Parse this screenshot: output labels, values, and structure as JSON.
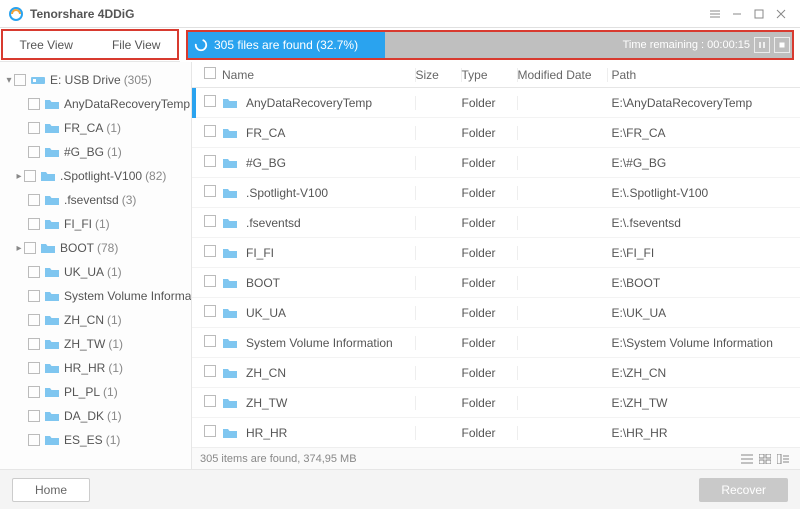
{
  "title": "Tenorshare 4DDiG",
  "view_tabs": {
    "tree": "Tree View",
    "file": "File View"
  },
  "progress": {
    "text": "305 files are found (32.7%)",
    "percent": 32.7,
    "time_remaining": "Time remaining : 00:00:15"
  },
  "sidebar": {
    "root": {
      "label": "E: USB Drive",
      "count": "(305)"
    },
    "items": [
      {
        "label": "AnyDataRecoveryTemp",
        "count": ""
      },
      {
        "label": "FR_CA",
        "count": "(1)"
      },
      {
        "label": "#G_BG",
        "count": "(1)"
      },
      {
        "label": ".Spotlight-V100",
        "count": "(82)",
        "expandable": true
      },
      {
        "label": ".fseventsd",
        "count": "(3)"
      },
      {
        "label": "FI_FI",
        "count": "(1)"
      },
      {
        "label": "BOOT",
        "count": "(78)",
        "expandable": true
      },
      {
        "label": "UK_UA",
        "count": "(1)"
      },
      {
        "label": "System Volume Information",
        "count": ""
      },
      {
        "label": "ZH_CN",
        "count": "(1)"
      },
      {
        "label": "ZH_TW",
        "count": "(1)"
      },
      {
        "label": "HR_HR",
        "count": "(1)"
      },
      {
        "label": "PL_PL",
        "count": "(1)"
      },
      {
        "label": "DA_DK",
        "count": "(1)"
      },
      {
        "label": "ES_ES",
        "count": "(1)"
      }
    ]
  },
  "table": {
    "headers": {
      "name": "Name",
      "size": "Size",
      "type": "Type",
      "date": "Modified Date",
      "path": "Path"
    },
    "rows": [
      {
        "name": "AnyDataRecoveryTemp",
        "type": "Folder",
        "path": "E:\\AnyDataRecoveryTemp",
        "selected": true
      },
      {
        "name": "FR_CA",
        "type": "Folder",
        "path": "E:\\FR_CA"
      },
      {
        "name": "#G_BG",
        "type": "Folder",
        "path": "E:\\#G_BG"
      },
      {
        "name": ".Spotlight-V100",
        "type": "Folder",
        "path": "E:\\.Spotlight-V100"
      },
      {
        "name": ".fseventsd",
        "type": "Folder",
        "path": "E:\\.fseventsd"
      },
      {
        "name": "FI_FI",
        "type": "Folder",
        "path": "E:\\FI_FI"
      },
      {
        "name": "BOOT",
        "type": "Folder",
        "path": "E:\\BOOT"
      },
      {
        "name": "UK_UA",
        "type": "Folder",
        "path": "E:\\UK_UA"
      },
      {
        "name": "System Volume Information",
        "type": "Folder",
        "path": "E:\\System Volume Information"
      },
      {
        "name": "ZH_CN",
        "type": "Folder",
        "path": "E:\\ZH_CN"
      },
      {
        "name": "ZH_TW",
        "type": "Folder",
        "path": "E:\\ZH_TW"
      },
      {
        "name": "HR_HR",
        "type": "Folder",
        "path": "E:\\HR_HR"
      }
    ]
  },
  "status": "305 items are found, 374,95 MB",
  "footer": {
    "home": "Home",
    "recover": "Recover"
  },
  "colors": {
    "accent": "#2aa3ef",
    "highlight_red": "#d83a2f",
    "folder": "#7fc6f0"
  }
}
